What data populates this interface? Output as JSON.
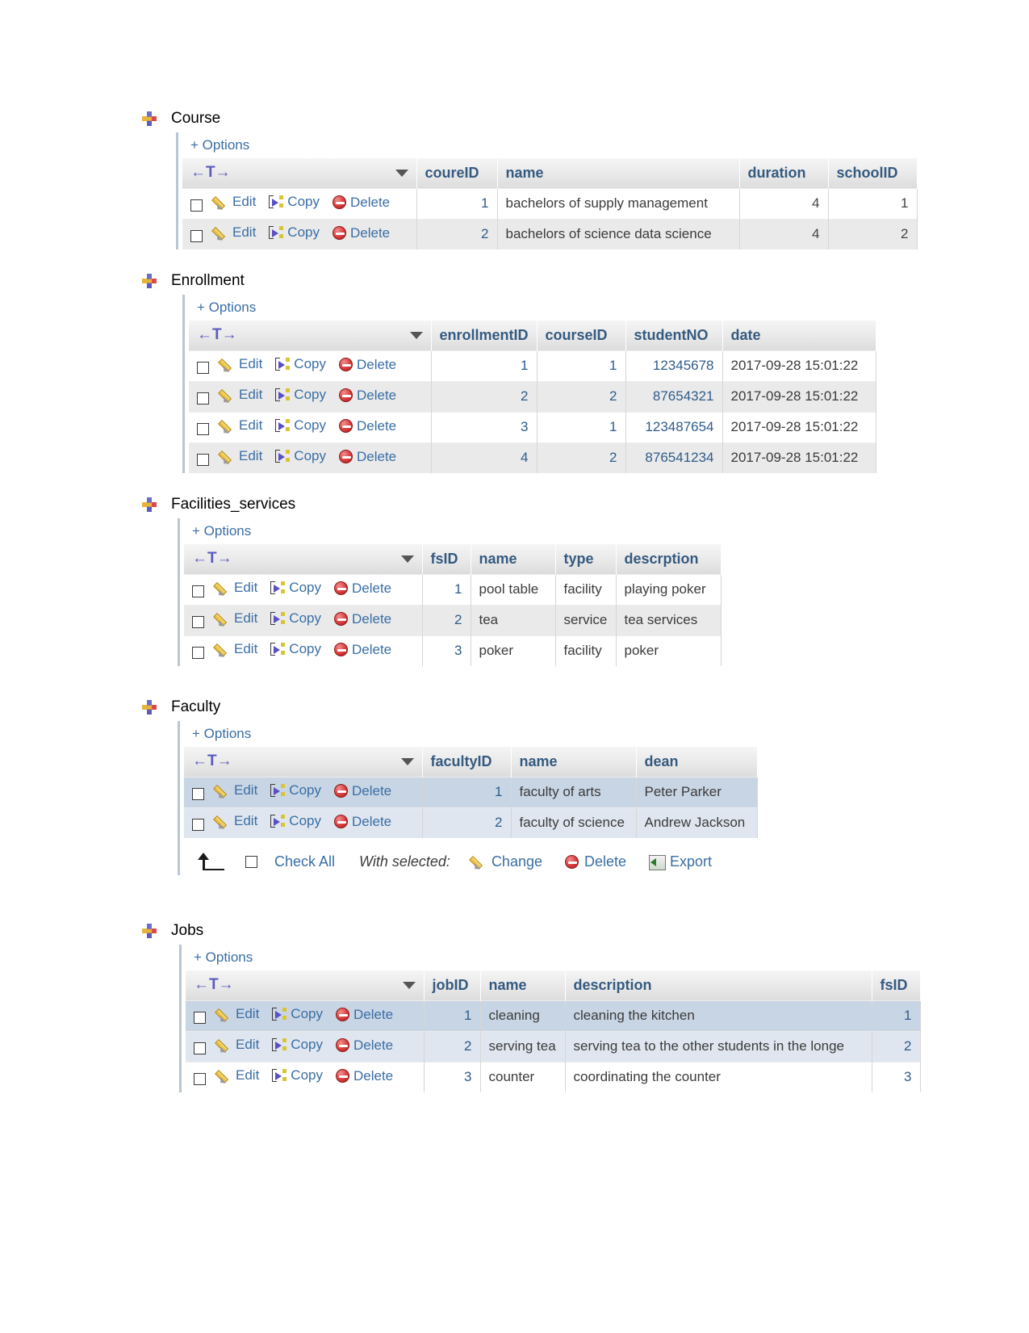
{
  "document": {
    "type": "phpmyadmin-table-dumps"
  },
  "common": {
    "options_label": "+ Options",
    "edit_label": "Edit",
    "copy_label": "Copy",
    "delete_label": "Delete",
    "sort_arrows": "←T→",
    "icons": {
      "bullet": "bullet-marker-icon",
      "pencil": "pencil-icon",
      "copy": "copy-rows-icon",
      "delete": "delete-circle-icon",
      "export": "export-icon",
      "caret": "chevron-down-icon",
      "checkbox": "checkbox-icon",
      "arrow_up": "arrow-up-left-icon"
    }
  },
  "toolbar": {
    "check_all_label": "Check All",
    "with_selected_label": "With selected:",
    "change_label": "Change",
    "delete_label": "Delete",
    "export_label": "Export"
  },
  "sections": [
    {
      "title": "Course",
      "columns": [
        "coureID",
        "name",
        "duration",
        "schoolID"
      ],
      "rows": [
        {
          "values": [
            "1",
            "bachelors of supply management",
            "4",
            "1"
          ],
          "stripe": "odd"
        },
        {
          "values": [
            "2",
            "bachelors of science data science",
            "4",
            "2"
          ],
          "stripe": "even"
        }
      ]
    },
    {
      "title": "Enrollment",
      "columns": [
        "enrollmentID",
        "courseID",
        "studentNO",
        "date"
      ],
      "rows": [
        {
          "values": [
            "1",
            "1",
            "12345678",
            "2017-09-28 15:01:22"
          ],
          "stripe": "odd"
        },
        {
          "values": [
            "2",
            "2",
            "87654321",
            "2017-09-28 15:01:22"
          ],
          "stripe": "even"
        },
        {
          "values": [
            "3",
            "1",
            "123487654",
            "2017-09-28 15:01:22"
          ],
          "stripe": "odd"
        },
        {
          "values": [
            "4",
            "2",
            "876541234",
            "2017-09-28 15:01:22"
          ],
          "stripe": "even"
        }
      ]
    },
    {
      "title": "Facilities_services",
      "columns": [
        "fsID",
        "name",
        "type",
        "descrption"
      ],
      "rows": [
        {
          "values": [
            "1",
            "pool table",
            "facility",
            "playing poker"
          ],
          "stripe": "odd"
        },
        {
          "values": [
            "2",
            "tea",
            "service",
            "tea services"
          ],
          "stripe": "even"
        },
        {
          "values": [
            "3",
            "poker",
            "facility",
            "poker"
          ],
          "stripe": "odd"
        }
      ]
    },
    {
      "title": "Faculty",
      "columns": [
        "facultyID",
        "name",
        "dean"
      ],
      "rows": [
        {
          "values": [
            "1",
            "faculty of arts",
            "Peter Parker"
          ],
          "stripe": "hl"
        },
        {
          "values": [
            "2",
            "faculty of science",
            "Andrew Jackson"
          ],
          "stripe": "hl2"
        }
      ]
    },
    {
      "title": "Jobs",
      "columns": [
        "jobID",
        "name",
        "description",
        "fsID"
      ],
      "rows": [
        {
          "values": [
            "1",
            "cleaning",
            "cleaning the kitchen",
            "1"
          ],
          "stripe": "hl"
        },
        {
          "values": [
            "2",
            "serving tea",
            "serving tea to the other students in the longe",
            "2"
          ],
          "stripe": "hl2"
        },
        {
          "values": [
            "3",
            "counter",
            "coordinating the counter",
            "3"
          ],
          "stripe": "odd"
        }
      ]
    }
  ]
}
